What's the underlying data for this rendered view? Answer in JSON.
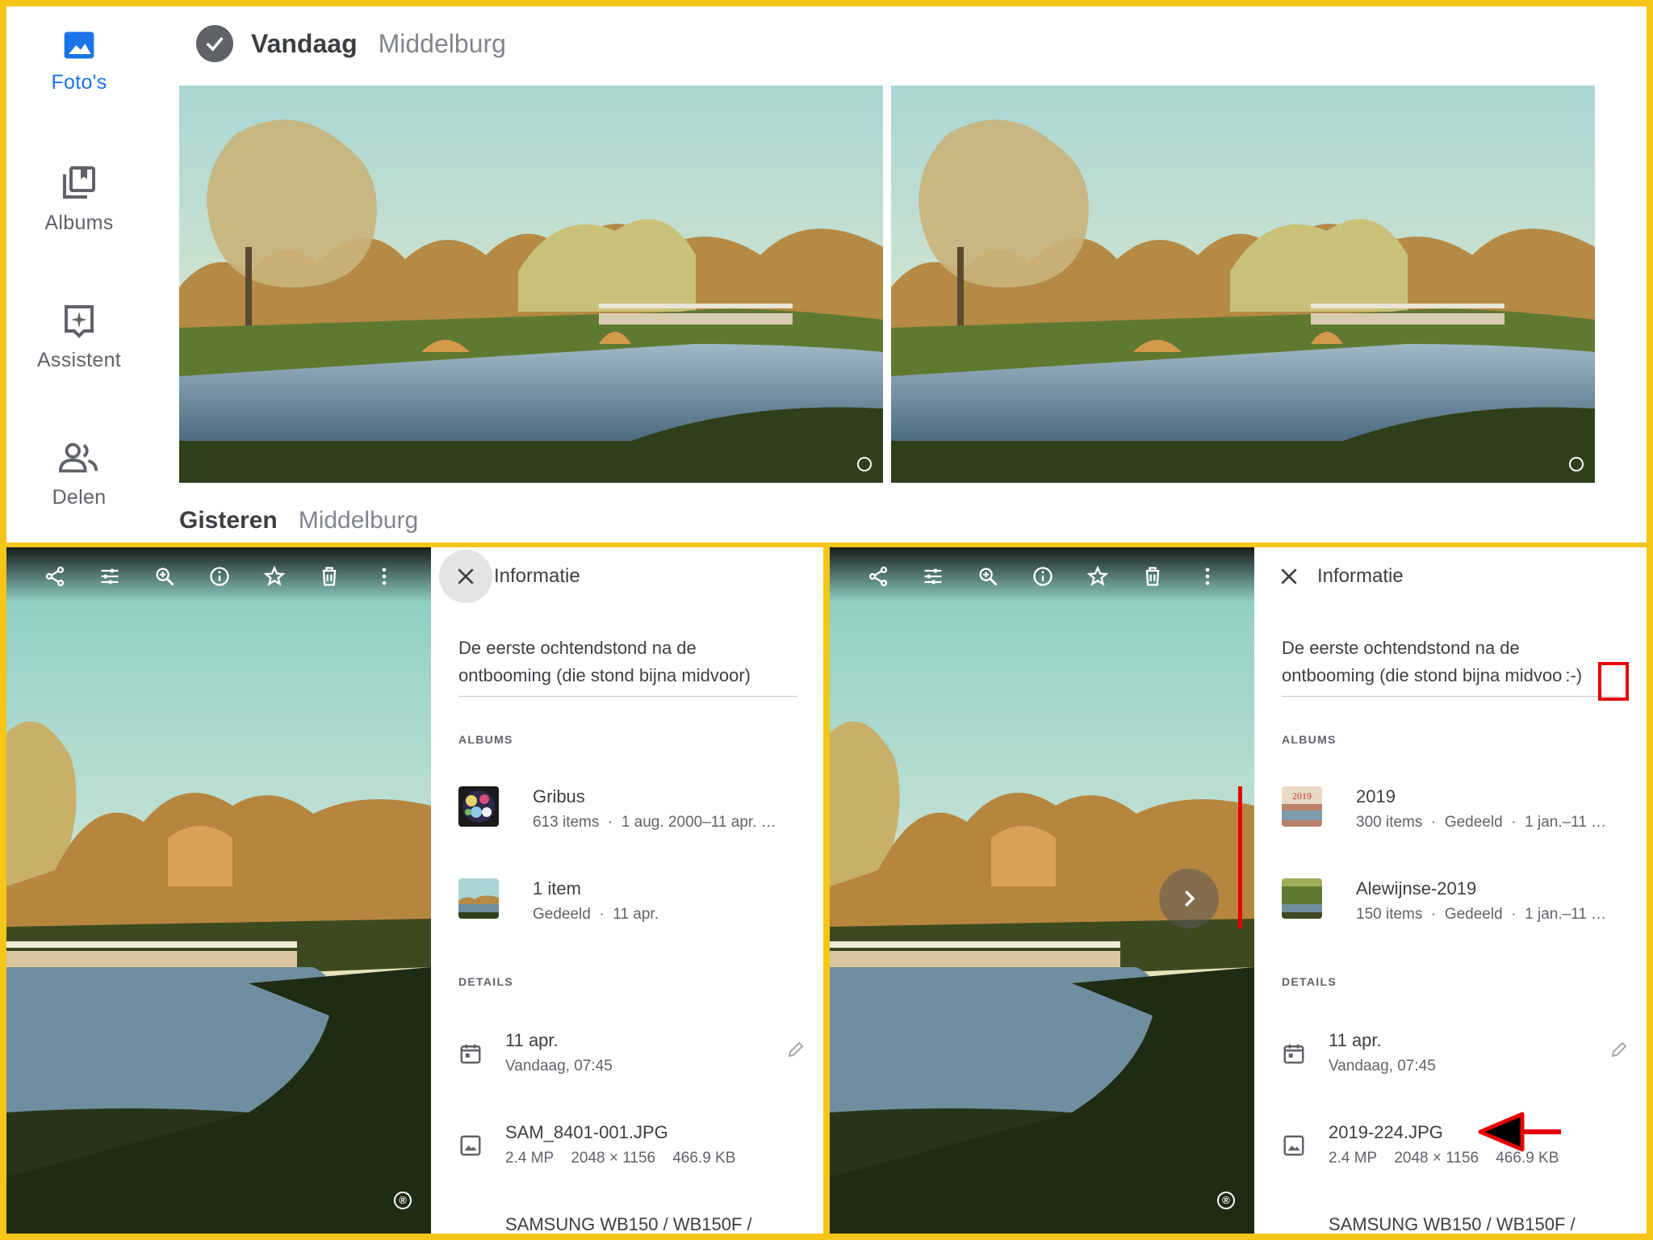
{
  "nav": {
    "items": [
      {
        "label": "Foto's",
        "icon": "photo-icon",
        "active": true
      },
      {
        "label": "Albums",
        "icon": "albums-icon"
      },
      {
        "label": "Assistent",
        "icon": "assistant-icon"
      },
      {
        "label": "Delen",
        "icon": "sharing-icon"
      }
    ]
  },
  "grid": {
    "group1": {
      "date": "Vandaag",
      "location": "Middelburg"
    },
    "group2": {
      "date": "Gisteren",
      "location": "Middelburg"
    }
  },
  "viewer": {
    "toolbar_icons": [
      "share-icon",
      "edit-adjust-icon",
      "zoom-icon",
      "info-icon",
      "star-icon",
      "trash-icon",
      "more-icon"
    ],
    "corner_mark": "®"
  },
  "panel_left": {
    "title": "Informatie",
    "description": [
      "De eerste ochtendstond na de",
      "ontbooming (die stond bijna midvoor)"
    ],
    "albums_label": "ALBUMS",
    "albums": [
      {
        "name": "Gribus",
        "count": "613 items",
        "meta": "1 aug. 2000–11 apr. …"
      },
      {
        "name": "1 item",
        "count": "Gedeeld",
        "meta": "11 apr."
      }
    ],
    "details_label": "DETAILS",
    "date": {
      "main": "11 apr.",
      "sub": "Vandaag, 07:45"
    },
    "file": {
      "name": "SAM_8401-001.JPG",
      "mp": "2.4 MP",
      "dims": "2048 × 1156",
      "size": "466.9 KB"
    },
    "camera": "SAMSUNG WB150 / WB150F /"
  },
  "panel_right": {
    "title": "Informatie",
    "description": [
      "De eerste ochtendstond na de",
      "ontbooming (die stond bijna midvoo"
    ],
    "smiley": ":-)",
    "albums_label": "ALBUMS",
    "albums": [
      {
        "name": "2019",
        "count": "300 items",
        "shared": "Gedeeld",
        "meta": "1 jan.–11 …",
        "thumb_text": "2019"
      },
      {
        "name": "Alewijnse-2019",
        "count": "150 items",
        "shared": "Gedeeld",
        "meta": "1 jan.–11 …"
      }
    ],
    "details_label": "DETAILS",
    "date": {
      "main": "11 apr.",
      "sub": "Vandaag, 07:45"
    },
    "file": {
      "name": "2019-224.JPG",
      "mp": "2.4 MP",
      "dims": "2048 × 1156",
      "size": "466.9 KB"
    },
    "camera": "SAMSUNG WB150 / WB150F /"
  },
  "colors": {
    "frame": "#f5c518",
    "accent": "#1a73e8",
    "annotation": "#e60000"
  }
}
